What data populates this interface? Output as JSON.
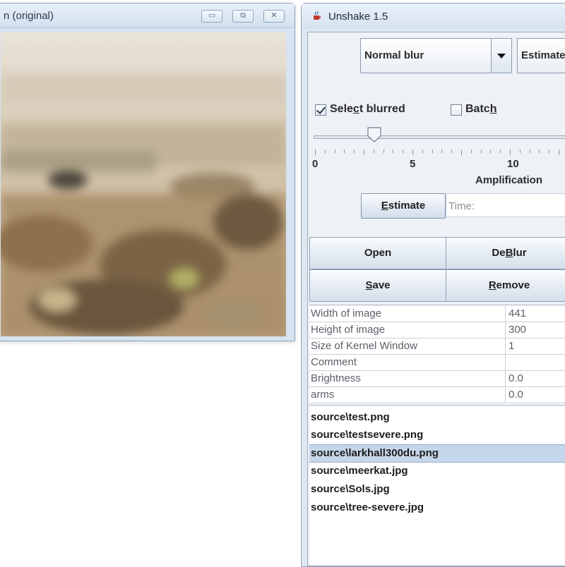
{
  "image_window": {
    "title": "n (original)",
    "buttons": [
      "minimize",
      "maximize",
      "close"
    ]
  },
  "main_window": {
    "title": "Unshake 1.5",
    "blur_type": {
      "selected": "Normal blur"
    },
    "mode": {
      "selected": "Estimate"
    },
    "select_blurred": {
      "label_pre": "Sele",
      "mnemonic": "c",
      "label_post": "t blurred",
      "checked": true
    },
    "batch": {
      "label_pre": "Batc",
      "mnemonic": "h",
      "label_post": "",
      "checked": false
    },
    "slider": {
      "value": 3,
      "tick_labels": [
        "0",
        "5",
        "10"
      ],
      "label": "Amplification"
    },
    "estimate_button": {
      "mnemonic": "E",
      "rest": "stimate"
    },
    "time_label": "Time:",
    "buttons": {
      "open": "Open",
      "deblur_pre": "De",
      "deblur_mn": "B",
      "deblur_post": "lur",
      "save_mn": "S",
      "save_post": "ave",
      "remove_mn": "R",
      "remove_post": "emove"
    },
    "properties": [
      {
        "key": "Width of image",
        "value": "441"
      },
      {
        "key": "Height of image",
        "value": "300"
      },
      {
        "key": "Size of Kernel Window",
        "value": "1"
      },
      {
        "key": "Comment",
        "value": ""
      },
      {
        "key": "Brightness",
        "value": "0.0"
      },
      {
        "key": "arms",
        "value": "0.0"
      }
    ],
    "files": [
      {
        "name": "source\\test.png",
        "selected": false
      },
      {
        "name": "source\\testsevere.png",
        "selected": false
      },
      {
        "name": "source\\larkhall300du.png",
        "selected": true
      },
      {
        "name": "source\\meerkat.jpg",
        "selected": false
      },
      {
        "name": "source\\Sols.jpg",
        "selected": false
      },
      {
        "name": "source\\tree-severe.jpg",
        "selected": false
      }
    ]
  },
  "colors": {
    "window_frame": "#dfe8f2",
    "selection": "#c6d6ea",
    "button_border": "#7f93ad"
  }
}
